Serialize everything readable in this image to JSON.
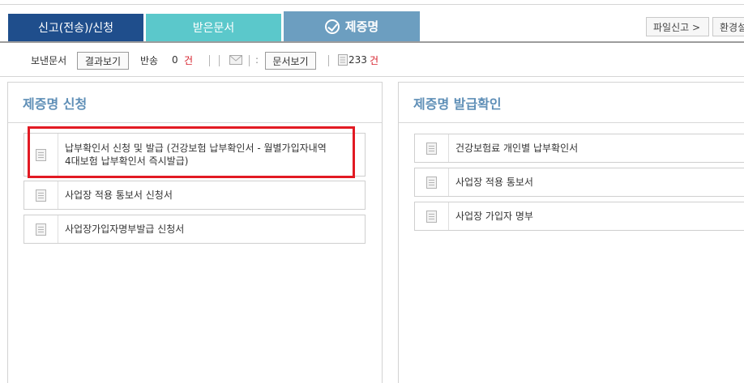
{
  "tabs": {
    "send": "신고(전송)/신청",
    "received": "받은문서",
    "certificate": "제증명"
  },
  "top_buttons": {
    "file_report": "파일신고 >",
    "settings": "환경설정"
  },
  "toolbar": {
    "sent_docs_label": "보낸문서",
    "view_results_button": "결과보기",
    "returned_label": "반송",
    "returned_count": "0",
    "returned_unit": "건",
    "view_docs_button": "문서보기",
    "doc_count": "233",
    "doc_unit": "건"
  },
  "left_panel": {
    "title": "제증명 신청",
    "items": [
      {
        "line1": "납부확인서 신청 및 발급 (건강보험 납부확인서 - 월별가입자내역",
        "line2": "4대보험 납부확인서 즉시발급)"
      },
      {
        "line1": "사업장 적용 통보서 신청서"
      },
      {
        "line1": "사업장가입자명부발급 신청서"
      }
    ]
  },
  "right_panel": {
    "title": "제증명 발급확인",
    "items": [
      {
        "line1": "건강보험료 개인별 납부확인서"
      },
      {
        "line1": "사업장 적용 통보서"
      },
      {
        "line1": "사업장 가입자 명부"
      }
    ]
  },
  "colors": {
    "tab_send": "#1f4e8c",
    "tab_received": "#5bc8cb",
    "tab_certificate": "#6c9ec0",
    "panel_title": "#5f8fb7",
    "highlight": "#e21a23",
    "count_red": "#d6202c"
  },
  "icons": [
    "check-circle-icon",
    "envelope-icon",
    "document-icon"
  ]
}
